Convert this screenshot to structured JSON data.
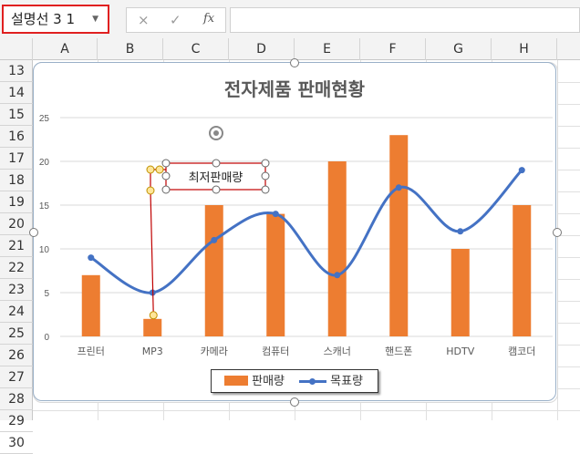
{
  "name_box": {
    "value": "설명선 3 1"
  },
  "formula_bar": {
    "cancel_icon": "×",
    "enter_icon": "✓",
    "fx_label": "fx",
    "value": ""
  },
  "columns": [
    "A",
    "B",
    "C",
    "D",
    "E",
    "F",
    "G",
    "H"
  ],
  "rows": [
    "13",
    "14",
    "15",
    "16",
    "17",
    "18",
    "19",
    "20",
    "21",
    "22",
    "23",
    "24",
    "25",
    "26",
    "27",
    "28",
    "29",
    "30"
  ],
  "colors": {
    "bar": "#ED7D31",
    "line": "#4472C4",
    "name_box_border": "#E02020",
    "callout_line": "#C00000"
  },
  "callout": {
    "text": "최저판매량"
  },
  "chart_data": {
    "type": "bar",
    "title": "전자제품 판매현황",
    "categories": [
      "프린터",
      "MP3",
      "카메라",
      "컴퓨터",
      "스캐너",
      "핸드폰",
      "HDTV",
      "캠코더"
    ],
    "series": [
      {
        "name": "판매량",
        "type": "bar",
        "values": [
          7,
          2,
          15,
          14,
          20,
          23,
          10,
          15
        ]
      },
      {
        "name": "목표량",
        "type": "line",
        "smooth": true,
        "values": [
          9,
          5,
          11,
          14,
          7,
          17,
          12,
          19
        ]
      }
    ],
    "yticks": [
      "0",
      "5",
      "10",
      "15",
      "20",
      "25"
    ],
    "ylim": [
      0,
      25
    ],
    "grid": true,
    "legend": "bottom"
  }
}
